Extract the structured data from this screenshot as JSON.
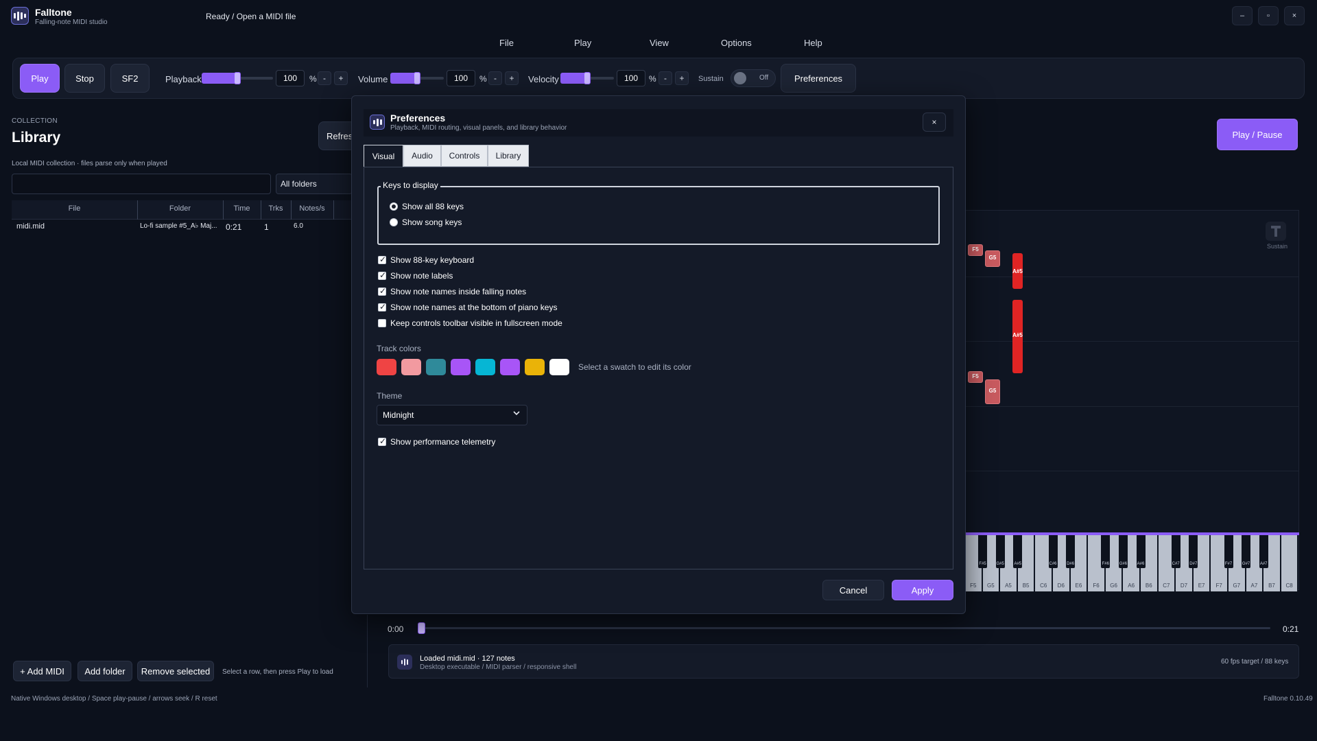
{
  "app": {
    "name": "Falltone",
    "tagline": "Falling-note MIDI studio",
    "status": "Ready / Open a MIDI file",
    "window_controls": [
      "–",
      "▫",
      "×"
    ]
  },
  "menu": [
    "File",
    "Play",
    "View",
    "Options",
    "Help"
  ],
  "toolbar": {
    "play": "Play",
    "stop": "Stop",
    "sf2": "SF2",
    "playback_label": "Playback",
    "playback_value": "100",
    "volume_label": "Volume",
    "volume_value": "100",
    "velocity_label": "Velocity",
    "velocity_value": "100",
    "percent": "%",
    "minus": "-",
    "plus": "+",
    "sustain_label": "Sustain",
    "sustain_state": "Off",
    "preferences": "Preferences"
  },
  "library": {
    "section": "COLLECTION",
    "title": "Library",
    "refresh": "Refresh",
    "description": "Local MIDI collection · files parse only when played",
    "search_value": "",
    "folder_select": "All folders",
    "columns": [
      "File",
      "Folder",
      "Time",
      "Trks",
      "Notes/s"
    ],
    "rows": [
      {
        "file": "midi.mid",
        "folder": "Lo-fi sample #5_A♭ Maj...",
        "time": "0:21",
        "trks": "1",
        "notes": "6.0"
      }
    ],
    "add_midi": "+ Add MIDI",
    "add_folder": "Add folder",
    "remove_selected": "Remove selected",
    "hint": "Select a row, then press Play to load"
  },
  "player": {
    "play_pause": "Play / Pause",
    "sustain_pedal_label": "Sustain",
    "notes": [
      {
        "name": "F5",
        "style": "soft"
      },
      {
        "name": "G5",
        "style": "soft"
      },
      {
        "name": "A#5",
        "style": "hot"
      },
      {
        "name": "A#5",
        "style": "hot"
      },
      {
        "name": "F5",
        "style": "soft"
      },
      {
        "name": "G5",
        "style": "soft"
      }
    ],
    "white_keys": [
      "F5",
      "G5",
      "A5",
      "B5",
      "C6",
      "D6",
      "E6",
      "F6",
      "G6",
      "A6",
      "B6",
      "C7",
      "D7",
      "E7",
      "F7",
      "G7",
      "A7",
      "B7",
      "C8"
    ],
    "black_keys": [
      "F#5",
      "G#5",
      "A#5",
      "C#6",
      "D#6",
      "F#6",
      "G#6",
      "A#6",
      "C#7",
      "D#7",
      "F#7",
      "G#7",
      "A#7"
    ],
    "time_start": "0:00",
    "time_end": "0:21",
    "position_fraction": 0.0
  },
  "info": {
    "title": "Loaded midi.mid · 127 notes",
    "subtitle": "Desktop executable / MIDI parser / responsive shell",
    "right": "60 fps target / 88 keys"
  },
  "footer": {
    "left": "Native Windows desktop / Space play-pause / arrows seek / R reset",
    "right": "Falltone 0.10.49"
  },
  "modal": {
    "title": "Preferences",
    "subtitle": "Playback, MIDI routing, visual panels, and library behavior",
    "close": "×",
    "tabs": [
      "Visual",
      "Audio",
      "Controls",
      "Library"
    ],
    "active_tab": "Visual",
    "keys_group_label": "Keys to display",
    "radios": [
      {
        "label": "Show all 88 keys",
        "checked": true
      },
      {
        "label": "Show song keys",
        "checked": false
      }
    ],
    "checks": [
      {
        "label": "Show 88-key keyboard",
        "checked": true
      },
      {
        "label": "Show note labels",
        "checked": true
      },
      {
        "label": "Show note names inside falling notes",
        "checked": true
      },
      {
        "label": "Show note names at the bottom of piano keys",
        "checked": true
      },
      {
        "label": "Keep controls toolbar visible in fullscreen mode",
        "checked": false
      }
    ],
    "track_colors_label": "Track colors",
    "swatches": [
      "#ef4444",
      "#f29aa0",
      "#2f8a9a",
      "#a855f7",
      "#06b6d4",
      "#a855f7",
      "#eab308",
      "#ffffff"
    ],
    "swatch_hint": "Select a swatch to edit its color",
    "theme_label": "Theme",
    "theme_value": "Midnight",
    "telemetry": {
      "label": "Show performance telemetry",
      "checked": true
    },
    "cancel": "Cancel",
    "apply": "Apply"
  },
  "colors": {
    "accent": "#8b5cf6",
    "background": "#0c111c",
    "note_hot": "#e02424",
    "note_soft": "#c85a5f"
  },
  "sliders": {
    "playback": 0.5,
    "volume": 0.5,
    "velocity": 0.5
  }
}
